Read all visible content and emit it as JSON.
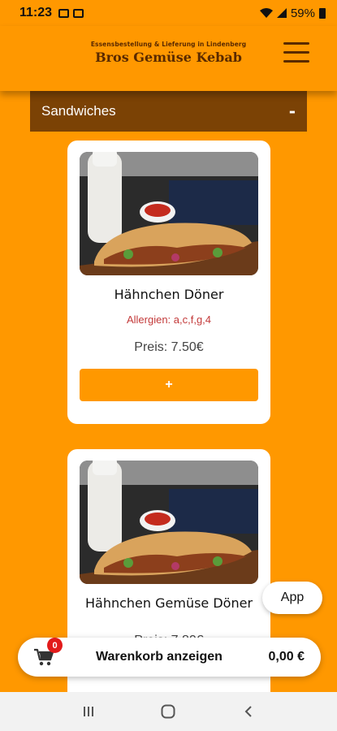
{
  "status_bar": {
    "time": "11:23",
    "battery": "59%"
  },
  "header": {
    "subtitle": "Essensbestellung & Lieferung in Lindenberg",
    "title": "Bros Gemüse Kebab"
  },
  "section": {
    "title": "Sandwiches",
    "toggle": "-"
  },
  "products": [
    {
      "name": "Hähnchen Döner",
      "allergens": "Allergien: a,c,f,g,4",
      "price": "Preis: 7.50€",
      "add_label": "+"
    },
    {
      "name": "Hähnchen Gemüse Döner",
      "allergens": "",
      "price": "Preis: 7.80€",
      "add_label": "+"
    }
  ],
  "app_button": {
    "label": "App"
  },
  "cart": {
    "count": "0",
    "label": "Warenkorb anzeigen",
    "total": "0,00 €"
  },
  "colors": {
    "brand_orange": "#ff9800",
    "section_brown": "#7b4205",
    "allergy_red": "#c33a3a",
    "badge_red": "#e21b1b"
  },
  "icons": [
    "gallery-icon",
    "mail-icon",
    "wifi-icon",
    "signal-icon",
    "battery-icon",
    "hamburger-menu-icon",
    "cart-icon",
    "recents-icon",
    "home-icon",
    "back-icon"
  ]
}
